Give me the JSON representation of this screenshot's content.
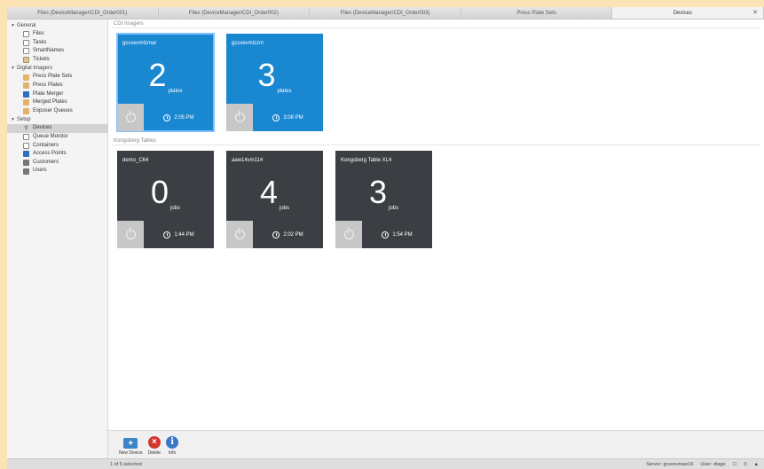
{
  "tabs": [
    {
      "label": "Files (DeviceManager/CDI_Order001)"
    },
    {
      "label": "Files (DeviceManager/CDI_Order002)"
    },
    {
      "label": "Files (DeviceManager/CDI_Order003)"
    },
    {
      "label": "Press Plate Sets"
    },
    {
      "label": "Devices"
    }
  ],
  "sidebar": {
    "general": {
      "label": "General",
      "items": [
        {
          "label": "Files"
        },
        {
          "label": "Tasks"
        },
        {
          "label": "SmartNames"
        },
        {
          "label": "Tickets"
        }
      ]
    },
    "digital_imagers": {
      "label": "Digital Imagers",
      "items": [
        {
          "label": "Press Plate Sets"
        },
        {
          "label": "Press Plates"
        },
        {
          "label": "Plate Merger"
        },
        {
          "label": "Merged Plates"
        },
        {
          "label": "Exposer Queues"
        }
      ]
    },
    "setup": {
      "label": "Setup",
      "items": [
        {
          "label": "Devices"
        },
        {
          "label": "Queue Monitor"
        },
        {
          "label": "Containers"
        },
        {
          "label": "Access Points"
        },
        {
          "label": "Customers"
        },
        {
          "label": "Users"
        }
      ]
    }
  },
  "groups": {
    "cdi": {
      "label": "CDI Imagers",
      "cards": [
        {
          "name": "gcsxevmlzmar",
          "count": "2",
          "unit": "plates",
          "time": "2:05 PM"
        },
        {
          "name": "gcsxevmlzzm",
          "count": "3",
          "unit": "plates",
          "time": "3:08 PM"
        }
      ]
    },
    "kongsberg": {
      "label": "Kongsberg Tables",
      "cards": [
        {
          "name": "demo_C64",
          "count": "0",
          "unit": "jobs",
          "time": "1:44 PM"
        },
        {
          "name": "aaw14vm114",
          "count": "4",
          "unit": "jobs",
          "time": "2:02 PM"
        },
        {
          "name": "Kongsberg Table XL4",
          "count": "3",
          "unit": "jobs",
          "time": "1:54 PM"
        }
      ]
    }
  },
  "toolbar": {
    "new_label": "New Device",
    "delete_label": "Delete",
    "info_label": "Info"
  },
  "status": {
    "selection": "1 of 5 selected",
    "server": "Server: gcsxevmae16",
    "user": "User: diage",
    "count": "0"
  },
  "colors": {
    "cdi_card": "#1a87d1",
    "kongsberg_card": "#3b3f43",
    "background": "#fbe3b6"
  }
}
